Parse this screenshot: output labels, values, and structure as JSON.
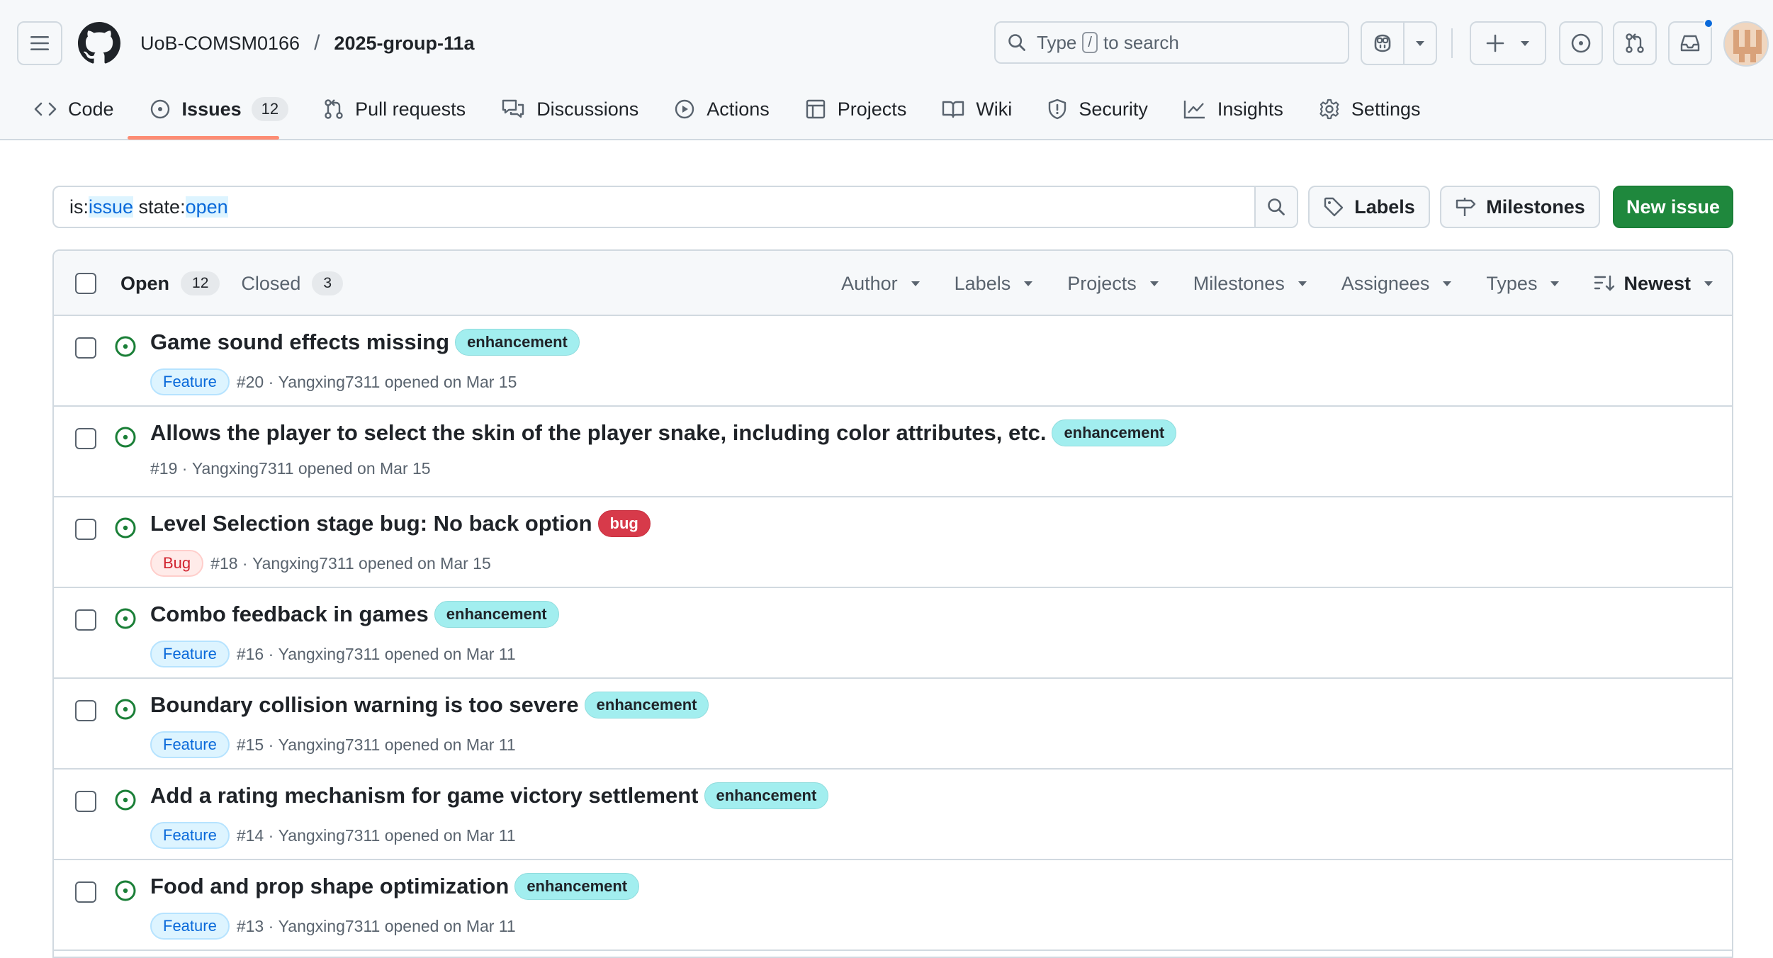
{
  "header": {
    "org": "UoB-COMSM0166",
    "separator": "/",
    "repo": "2025-group-11a",
    "search": {
      "prefix": "Type",
      "kbd": "/",
      "suffix": "to search"
    }
  },
  "nav": {
    "tabs": [
      {
        "label": "Code",
        "icon": "code-icon"
      },
      {
        "label": "Issues",
        "icon": "issue-opened-icon",
        "count": "12",
        "selected": true
      },
      {
        "label": "Pull requests",
        "icon": "git-pull-request-icon"
      },
      {
        "label": "Discussions",
        "icon": "comment-discussion-icon"
      },
      {
        "label": "Actions",
        "icon": "play-icon"
      },
      {
        "label": "Projects",
        "icon": "table-icon"
      },
      {
        "label": "Wiki",
        "icon": "book-icon"
      },
      {
        "label": "Security",
        "icon": "shield-icon"
      },
      {
        "label": "Insights",
        "icon": "graph-icon"
      },
      {
        "label": "Settings",
        "icon": "gear-icon"
      }
    ]
  },
  "filter": {
    "query_parts": [
      {
        "text": "is:",
        "hl": false
      },
      {
        "text": "issue",
        "hl": true
      },
      {
        "text": " state:",
        "hl": false
      },
      {
        "text": "open",
        "hl": true
      }
    ],
    "labels_btn": "Labels",
    "milestones_btn": "Milestones",
    "new_issue_btn": "New issue"
  },
  "list_header": {
    "open_label": "Open",
    "open_count": "12",
    "closed_label": "Closed",
    "closed_count": "3",
    "filters": [
      "Author",
      "Labels",
      "Projects",
      "Milestones",
      "Assignees",
      "Types"
    ],
    "sort_label": "Newest"
  },
  "issues": [
    {
      "title": "Game sound effects missing",
      "label": "enhancement",
      "label_kind": "enh",
      "type": "Feature",
      "number": "#20",
      "author": "Yangxing7311",
      "opened": "opened on Mar 15"
    },
    {
      "title": "Allows the player to select the skin of the player snake, including color attributes, etc.",
      "label": "enhancement",
      "label_kind": "enh",
      "type": "",
      "number": "#19",
      "author": "Yangxing7311",
      "opened": "opened on Mar 15"
    },
    {
      "title": "Level Selection stage bug: No back option",
      "label": "bug",
      "label_kind": "bug",
      "type": "Bug",
      "number": "#18",
      "author": "Yangxing7311",
      "opened": "opened on Mar 15"
    },
    {
      "title": "Combo feedback in games",
      "label": "enhancement",
      "label_kind": "enh",
      "type": "Feature",
      "number": "#16",
      "author": "Yangxing7311",
      "opened": "opened on Mar 11"
    },
    {
      "title": "Boundary collision warning is too severe",
      "label": "enhancement",
      "label_kind": "enh",
      "type": "Feature",
      "number": "#15",
      "author": "Yangxing7311",
      "opened": "opened on Mar 11"
    },
    {
      "title": "Add a rating mechanism for game victory settlement",
      "label": "enhancement",
      "label_kind": "enh",
      "type": "Feature",
      "number": "#14",
      "author": "Yangxing7311",
      "opened": "opened on Mar 11"
    },
    {
      "title": "Food and prop shape optimization",
      "label": "enhancement",
      "label_kind": "enh",
      "type": "Feature",
      "number": "#13",
      "author": "Yangxing7311",
      "opened": "opened on Mar 11"
    }
  ],
  "colors": {
    "accent": "#0969da",
    "open_green": "#1a7f37",
    "primary_button": "#1f883d",
    "tab_underline": "#fd8c73",
    "enhancement_label": "#a2eeef",
    "bug_label": "#d73a4a"
  }
}
